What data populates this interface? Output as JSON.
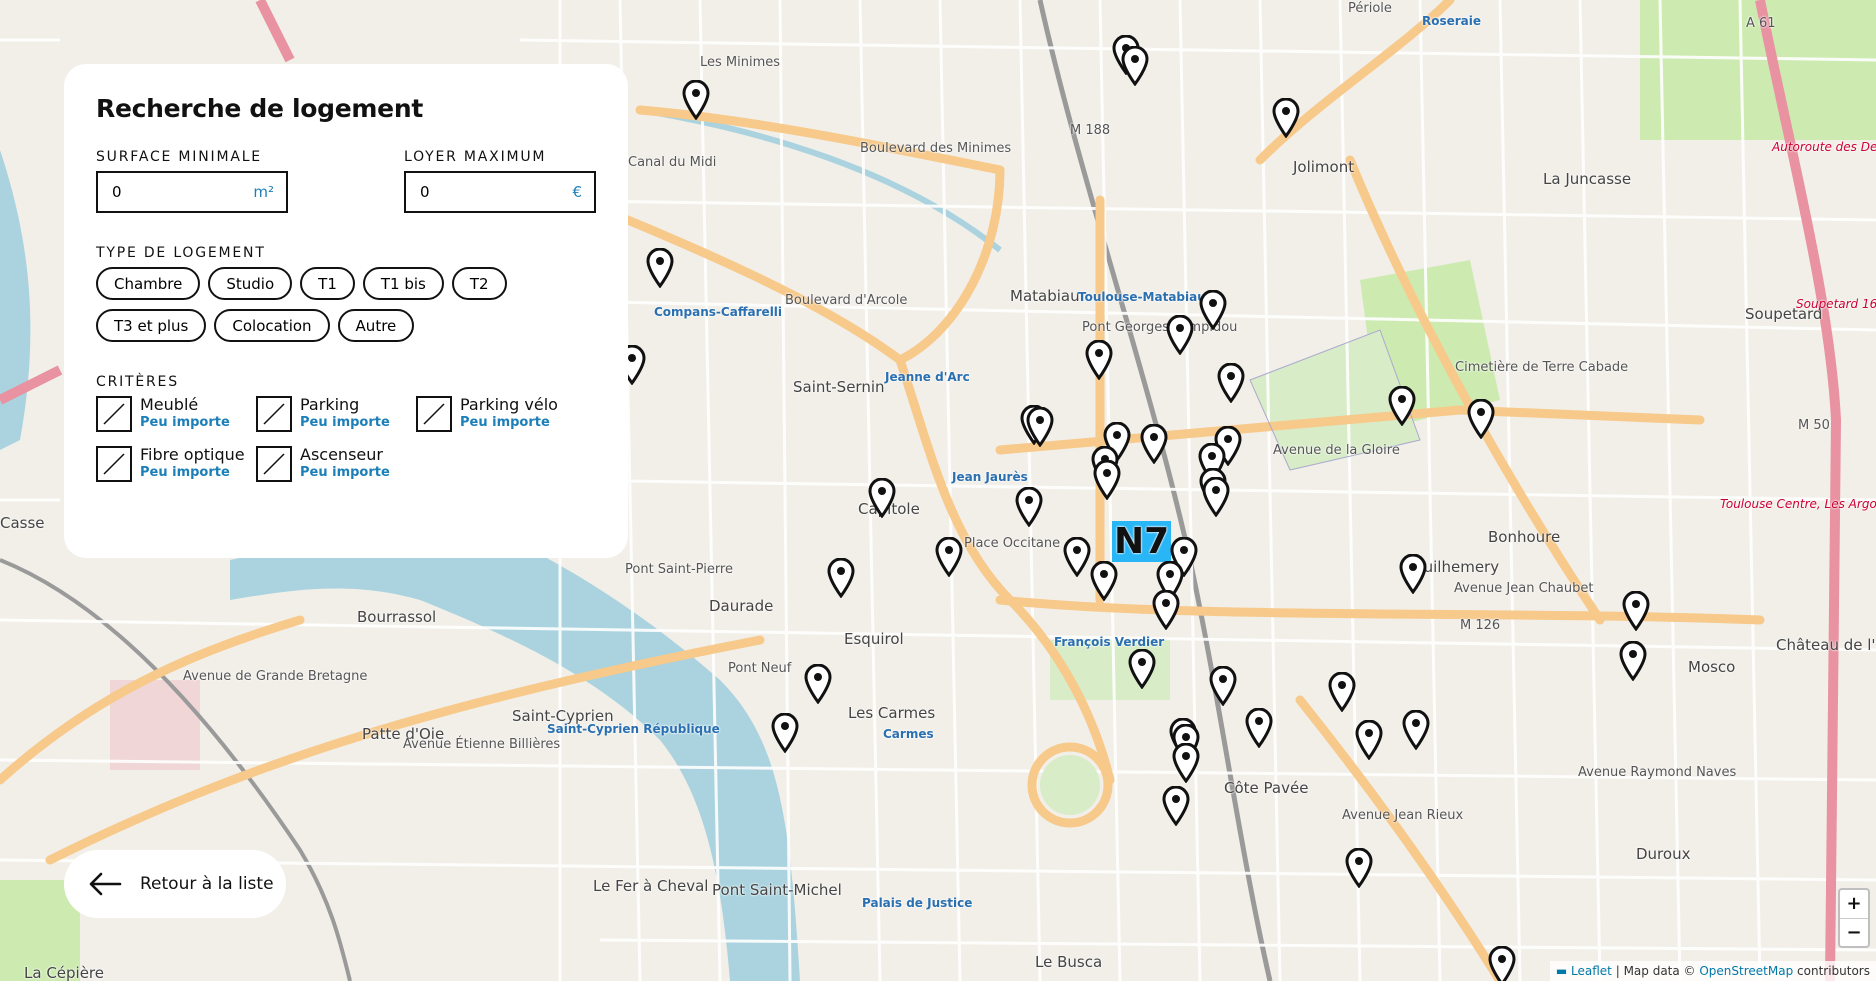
{
  "panel": {
    "title": "Recherche de logement",
    "surface": {
      "label": "SURFACE MINIMALE",
      "value": "0",
      "unit": "m²"
    },
    "loyer": {
      "label": "LOYER MAXIMUM",
      "value": "0",
      "unit": "€"
    },
    "type_label": "TYPE DE LOGEMENT",
    "types": [
      "Chambre",
      "Studio",
      "T1",
      "T1 bis",
      "T2",
      "T3 et plus",
      "Colocation",
      "Autre"
    ],
    "criteres_label": "CRITÈRES",
    "criteres": [
      {
        "name": "Meublé",
        "value": "Peu importe"
      },
      {
        "name": "Parking",
        "value": "Peu importe"
      },
      {
        "name": "Parking vélo",
        "value": "Peu importe"
      },
      {
        "name": "Fibre optique",
        "value": "Peu importe"
      },
      {
        "name": "Ascenseur",
        "value": "Peu importe"
      }
    ]
  },
  "back_button": {
    "label": "Retour à la liste",
    "icon": "arrow-left-icon"
  },
  "zoom": {
    "in": "+",
    "out": "−"
  },
  "attribution": {
    "leaflet": "Leaflet",
    "sep": " | Map data © ",
    "osm": "OpenStreetMap",
    "suffix": " contributors"
  },
  "map_labels": [
    "Les Minimes",
    "Canal du Midi",
    "Compans-Caffarelli",
    "Saint-Sernin",
    "Jeanne d'Arc",
    "Matabiau",
    "Toulouse-Matabiau",
    "Pont Georges Pompidou",
    "Jolimont",
    "La Juncasse",
    "Cimetière de Terre Cabade",
    "Soupetard",
    "Capitole",
    "Jean Jaurès",
    "Place Occitane",
    "Bonhoure",
    "Guilhemery",
    "Daurade",
    "Esquirol",
    "François Verdier",
    "Château de l'Hers",
    "Mosco",
    "Bourrassol",
    "Patte d'Oie",
    "Saint-Cyprien",
    "Saint-Cyprien République",
    "Les Carmes",
    "Carmes",
    "Côte Pavée",
    "Duroux",
    "Le Fer à Cheval",
    "Pont Saint-Michel",
    "Palais de Justice",
    "Le Busca",
    "La Cépière",
    "Pont Saint-Pierre",
    "Pont Neuf",
    "Périole",
    "Roseraie",
    "M 188",
    "M 126",
    "M 50",
    "A 61",
    "N7",
    "Casse",
    "Boulevard d'Arcole",
    "Boulevard des Minimes",
    "Avenue de la Gloire",
    "Avenue Jean Chaubet",
    "Avenue de Grande Bretagne",
    "Avenue Étienne Billières",
    "Avenue Jean Rieux",
    "Avenue Raymond Naves",
    "Autoroute des Deux Mers",
    "Toulouse Centre, Les Argoulets",
    "Soupetard 16"
  ],
  "marker_icon": "map-pin-icon",
  "colors": {
    "accent": "#1d7fb8",
    "panel": "#ffffff",
    "map_bg": "#f2efe9",
    "river": "#aad3df",
    "major_road": "#f7c98a"
  }
}
